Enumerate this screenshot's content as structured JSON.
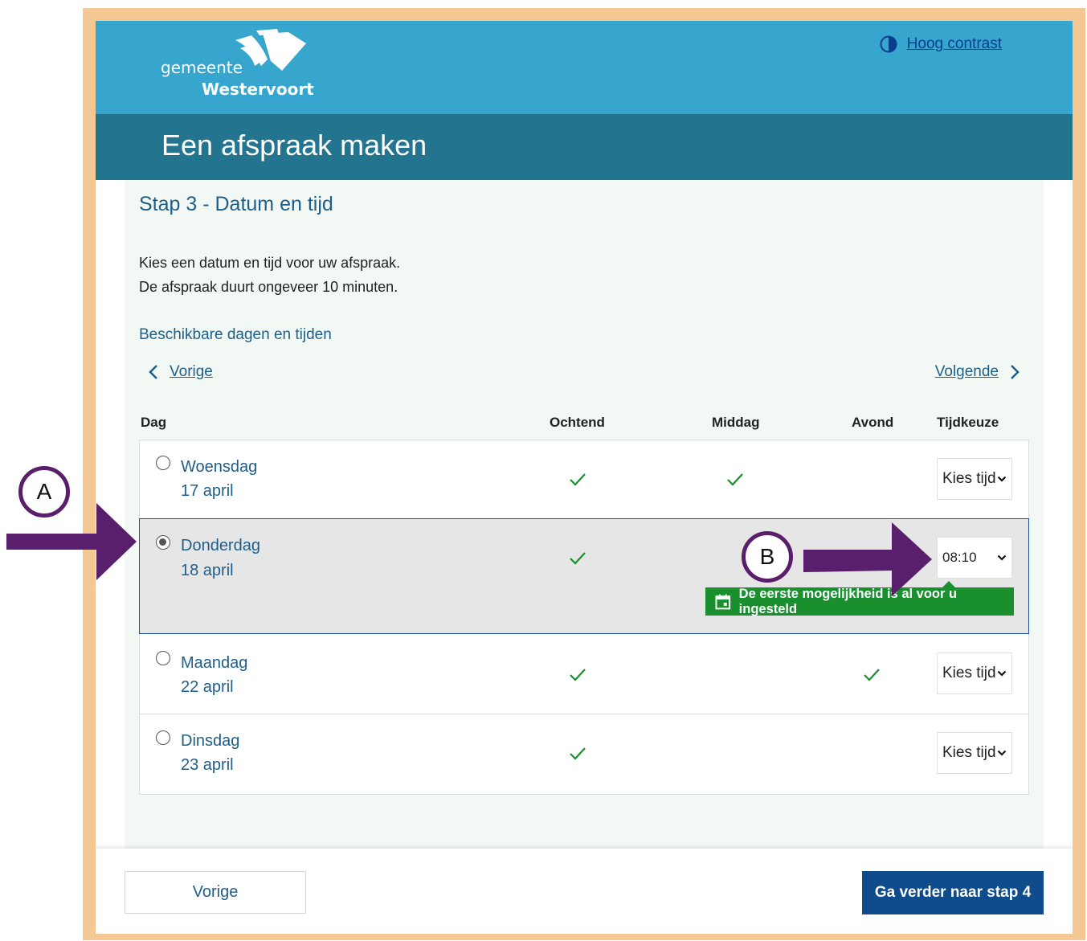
{
  "header": {
    "logo_line1": "gemeente",
    "logo_line2": "Westervoort",
    "contrast_label": "Hoog contrast",
    "page_title": "Een afspraak maken"
  },
  "main": {
    "step_title": "Stap 3 - Datum en tijd",
    "intro_line1": "Kies een datum en tijd voor uw afspraak.",
    "intro_line2": "De afspraak duurt ongeveer 10 minuten.",
    "available_heading": "Beschikbare dagen en tijden",
    "prev_link": "Vorige",
    "next_link": "Volgende",
    "columns": {
      "day": "Dag",
      "morning": "Ochtend",
      "afternoon": "Middag",
      "evening": "Avond",
      "time_choice": "Tijdkeuze"
    },
    "rows": [
      {
        "day": "Woensdag",
        "date": "17 april",
        "morning": true,
        "afternoon": true,
        "evening": false,
        "selected": false,
        "time": "Kies tijd"
      },
      {
        "day": "Donderdag",
        "date": "18 april",
        "morning": true,
        "afternoon": false,
        "evening": false,
        "selected": true,
        "time": "08:10"
      },
      {
        "day": "Maandag",
        "date": "22 april",
        "morning": true,
        "afternoon": false,
        "evening": true,
        "selected": false,
        "time": "Kies tijd"
      },
      {
        "day": "Dinsdag",
        "date": "23 april",
        "morning": true,
        "afternoon": false,
        "evening": false,
        "selected": false,
        "time": "Kies tijd"
      }
    ],
    "notice": "De eerste mogelijkheid is al voor u ingesteld"
  },
  "footer": {
    "back_button": "Vorige",
    "next_button": "Ga verder naar stap 4"
  },
  "annotations": {
    "a_label": "A",
    "b_label": "B"
  },
  "colors": {
    "frame": "#f4c893",
    "topbar": "#36a6cf",
    "titlebar": "#23748f",
    "link": "#1e5f8a",
    "check": "#1a8f2e",
    "primary_button": "#0f4c8b",
    "annotation": "#5a1f6c"
  }
}
